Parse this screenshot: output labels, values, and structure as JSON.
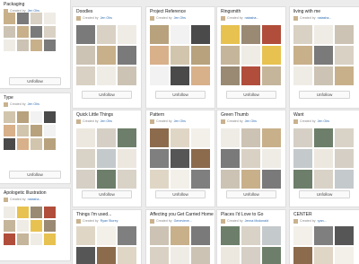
{
  "common": {
    "created_by": "Created by",
    "unfollow": "Unfollow"
  },
  "colors": {
    "page_bg": "#ececec",
    "link": "#2f6db5",
    "th": [
      [
        "#c8b08a",
        "#4d6ea0",
        "#e5c548",
        "#7a7a7a",
        "#ded8cf",
        "#b24032",
        "#d9d1c4",
        "#6c8f6a",
        "#2f2f2f",
        "#efece6",
        "#9c7f5a",
        "#5f6f7c",
        "#ccc3b4",
        "#8a9aa5",
        "#e3dccf"
      ],
      [
        "#f1eee8",
        "#d2c5ad",
        "#7f7f7f",
        "#e9e7e1",
        "#b7a27d",
        "#565656",
        "#e8c25a",
        "#f2f2f2",
        "#8c6b4d",
        "#cfd7dc",
        "#4a4a4a",
        "#e0d6c6",
        "#9aa8b0",
        "#d8b08a",
        "#f3f0e9"
      ],
      [
        "#3a3a3a",
        "#d9d2c7",
        "#efece6",
        "#8b6d4b",
        "#c4c9cc",
        "#e7c250",
        "#5b6e7a",
        "#ede8df",
        "#9a8a74",
        "#2d2d2d",
        "#d5cfc5",
        "#b14d3b",
        "#eae6de",
        "#6d7f6a",
        "#c5b59b"
      ]
    ]
  },
  "boards": [
    {
      "title": "Packaging",
      "author": "Jen Ohs"
    },
    {
      "title": "Type",
      "author": "Jen Ohs"
    },
    {
      "title": "Apologetic Illustration",
      "author": "natasha..."
    },
    {
      "title": "Doodles",
      "author": "Jen Ohs"
    },
    {
      "title": "Project Reference",
      "author": "Jen Ohs"
    },
    {
      "title": "Ringsmith",
      "author": "natasha..."
    },
    {
      "title": "living with me",
      "author": "natasha..."
    },
    {
      "title": "Quick Little Things",
      "author": "Jen Ohs"
    },
    {
      "title": "Pattern",
      "author": "Jen Ohs"
    },
    {
      "title": "Green Thumb",
      "author": "Jen Ohs"
    },
    {
      "title": "Want",
      "author": "Jen Ohs"
    },
    {
      "title": "Things I'm used...",
      "author": "Ryan Storey"
    },
    {
      "title": "Affecting you Get Carried Home",
      "author": "Genevieve..."
    },
    {
      "title": "Places I'd Love to Go",
      "author": "Jenna Mcdonald"
    },
    {
      "title": "CENTER",
      "author": "ryan..."
    }
  ]
}
